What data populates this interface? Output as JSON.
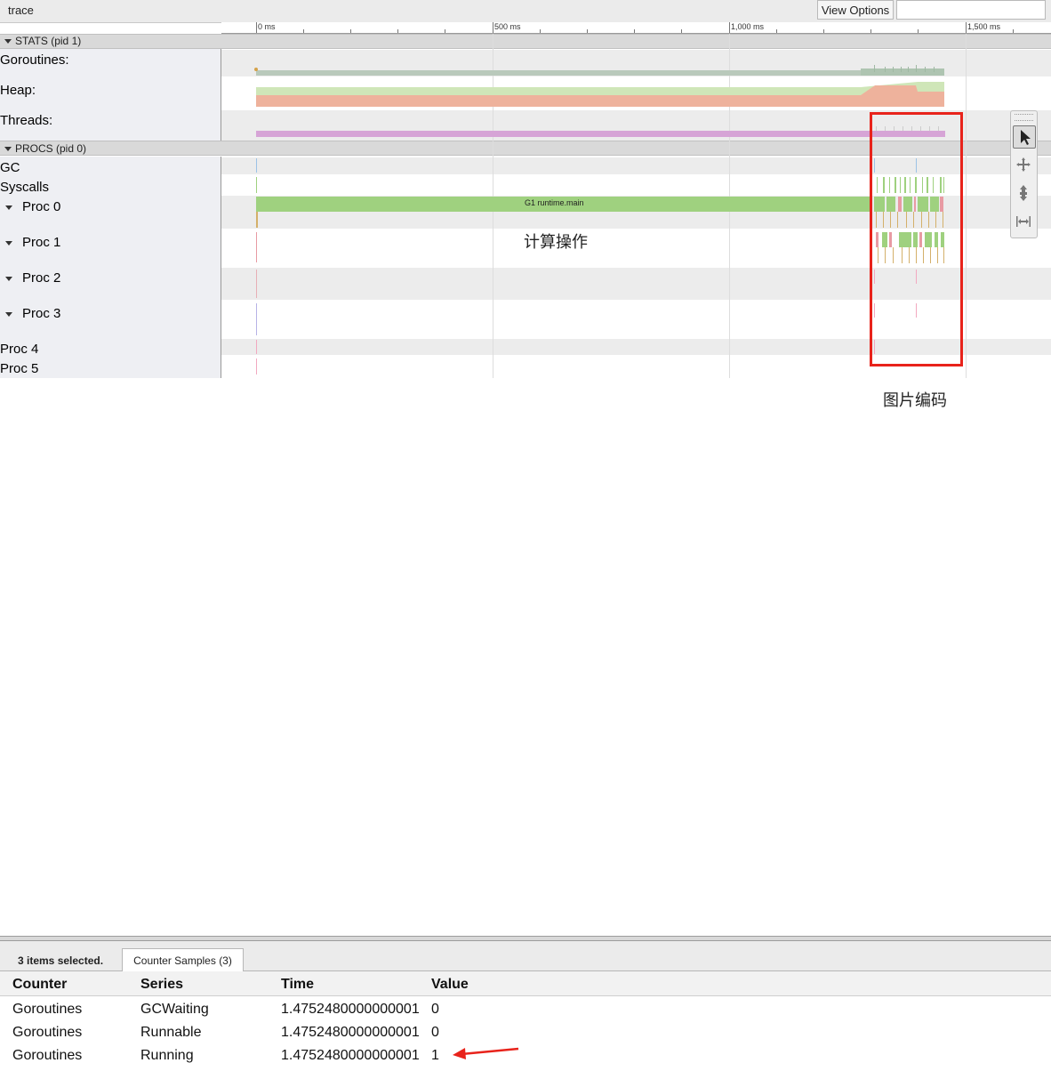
{
  "toolbar": {
    "title": "trace",
    "view_options_label": "View Options",
    "search_placeholder": ""
  },
  "ruler": {
    "ticks": [
      "0 ms",
      "500 ms",
      "1,000 ms",
      "1,500 ms"
    ]
  },
  "sections": {
    "stats": "STATS (pid 1)",
    "procs": "PROCS (pid 0)"
  },
  "stats_rows": [
    "Goroutines:",
    "Heap:",
    "Threads:"
  ],
  "procs_rows": [
    "GC",
    "Syscalls",
    "Proc 0",
    "Proc 1",
    "Proc 2",
    "Proc 3",
    "Proc 4",
    "Proc 5"
  ],
  "slices": {
    "main_slice": "G1 runtime.main"
  },
  "annotations": {
    "compute": "计算操作",
    "image_encode": "图片编码"
  },
  "colors": {
    "highlight": "#e8231b",
    "running_green": "#9fd17f",
    "heap_salmon": "#eeb29c",
    "heap_green": "#cfe6b8",
    "threads_purple": "#d6a4d6",
    "goroutines_gray": "#b9c9bb"
  },
  "bottom_panel": {
    "selection_count": "3 items selected.",
    "tab_label": "Counter Samples (3)",
    "columns": [
      "Counter",
      "Series",
      "Time",
      "Value"
    ],
    "rows": [
      [
        "Goroutines",
        "GCWaiting",
        "1.4752480000000001",
        "0"
      ],
      [
        "Goroutines",
        "Runnable",
        "1.4752480000000001",
        "0"
      ],
      [
        "Goroutines",
        "Running",
        "1.4752480000000001",
        "1"
      ]
    ]
  },
  "icons": {
    "select_tool": "cursor-arrow-icon",
    "pan_tool": "pan-cross-icon",
    "zoom_tool": "zoom-updown-icon",
    "timing_tool": "timing-width-icon"
  }
}
